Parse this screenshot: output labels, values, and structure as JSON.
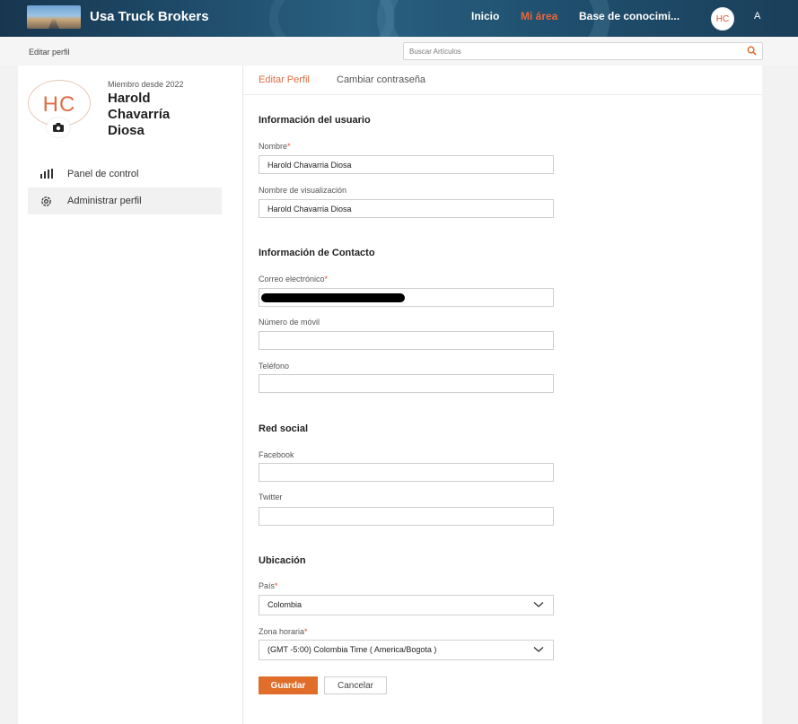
{
  "header": {
    "brand": "Usa Truck Brokers",
    "nav": [
      {
        "label": "Inicio"
      },
      {
        "label": "Mi área"
      },
      {
        "label": "Base de conocimi..."
      }
    ],
    "avatar_initials": "HC",
    "font_toggle": "A",
    "accent_color": "#e06d42"
  },
  "subbar": {
    "breadcrumb": "Editar perfil",
    "search_placeholder": "Buscar Artículos",
    "search_icon": "search-icon"
  },
  "profile": {
    "initials": "HC",
    "member_since": "Miembro desde 2022",
    "name_line1": "Harold",
    "name_line2": "Chavarría",
    "name_line3": "Diosa",
    "camera_icon": "camera-icon"
  },
  "sidebar": {
    "items": [
      {
        "label": "Panel de control",
        "icon": "bar-chart-icon"
      },
      {
        "label": "Administrar perfil",
        "icon": "gear-icon"
      }
    ]
  },
  "tabs": [
    {
      "label": "Editar Perfil"
    },
    {
      "label": "Cambiar contraseña"
    }
  ],
  "form": {
    "user_info_title": "Información del usuario",
    "name_label": "Nombre",
    "name_value": "Harold Chavarria Diosa",
    "display_label": "Nombre de visualización",
    "display_value": "Harold Chavarria Diosa",
    "contact_title": "Información de Contacto",
    "email_label": "Correo electrónico",
    "mobile_label": "Número de móvil",
    "phone_label": "Teléfono",
    "social_title": "Red social",
    "facebook_label": "Facebook",
    "twitter_label": "Twitter",
    "location_title": "Ubicación",
    "country_label": "País",
    "country_value": "Colombia",
    "tz_label": "Zona horaria",
    "tz_value": "(GMT -5:00) Colombia Time ( America/Bogota )",
    "required_mark": "*"
  },
  "buttons": {
    "save": "Guardar",
    "cancel": "Cancelar"
  }
}
